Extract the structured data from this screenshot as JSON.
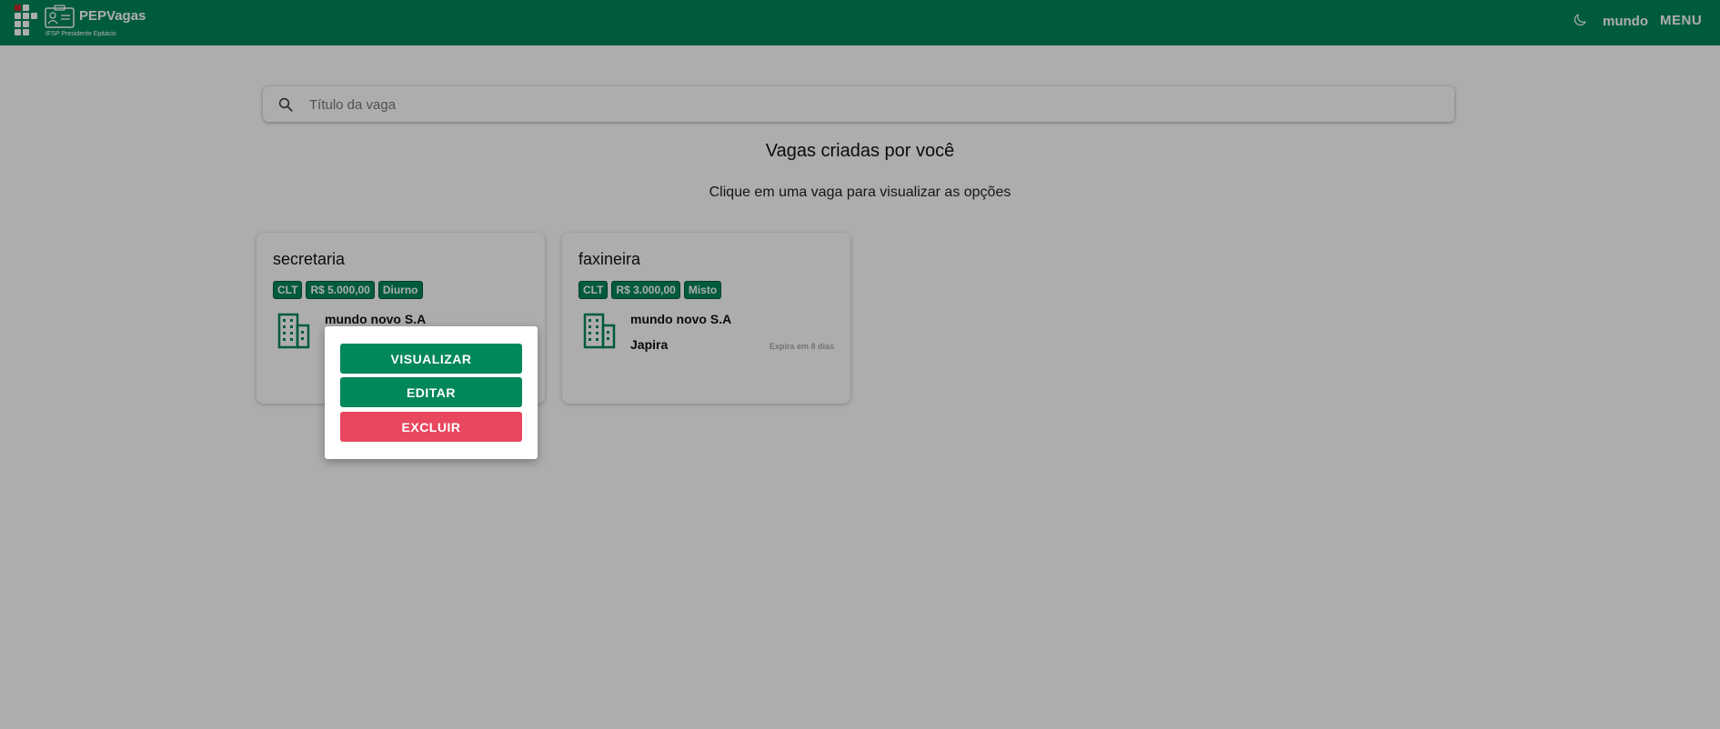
{
  "colors": {
    "brand": "#00875a",
    "danger": "#e8475f",
    "logo_accent": "#c62828"
  },
  "header": {
    "brand": "PEPVagas",
    "subtitle": "IFSP Presidente Epitácio",
    "theme_icon": "moon-icon",
    "user_name": "mundo",
    "menu_label": "MENU"
  },
  "search": {
    "placeholder": "Título da vaga",
    "value": "",
    "icon": "search-icon"
  },
  "main": {
    "title": "Vagas criadas por você",
    "hint": "Clique em uma vaga para visualizar as opções"
  },
  "jobs": [
    {
      "title": "secretaria",
      "tags": [
        "CLT",
        "R$ 5.000,00",
        "Diurno"
      ],
      "company": "mundo novo S.A",
      "icon": "building-icon"
    },
    {
      "title": "faxineira",
      "tags": [
        "CLT",
        "R$ 3.000,00",
        "Misto"
      ],
      "company": "mundo novo S.A",
      "city": "Japira",
      "expires": "Expira em 8 dias",
      "icon": "building-icon"
    }
  ],
  "popover": {
    "view_label": "VISUALIZAR",
    "edit_label": "EDITAR",
    "delete_label": "EXCLUIR"
  }
}
